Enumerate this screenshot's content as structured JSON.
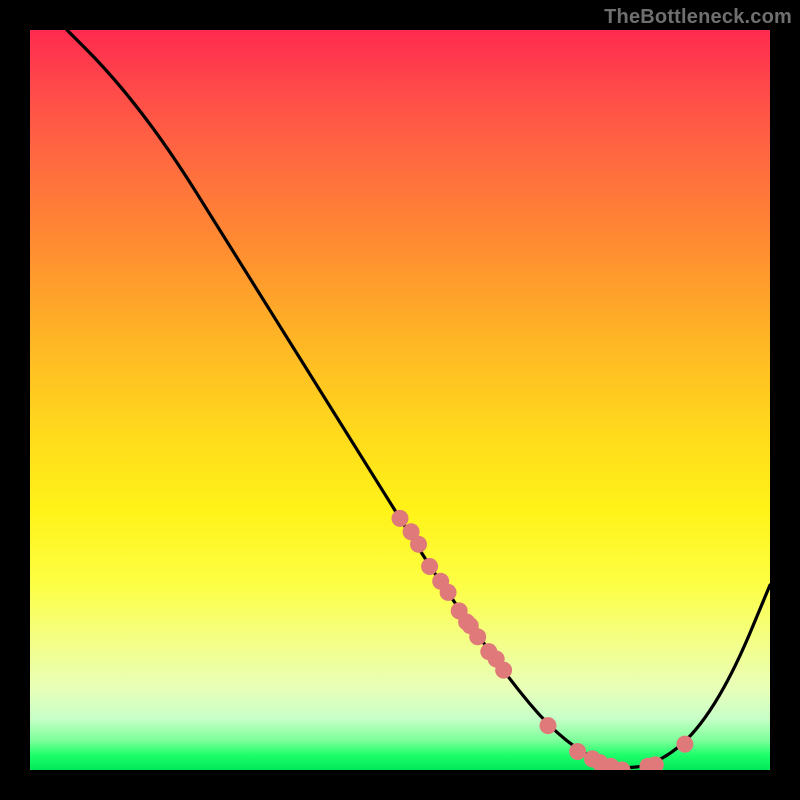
{
  "watermark": "TheBottleneck.com",
  "chart_data": {
    "type": "line",
    "title": "",
    "xlabel": "",
    "ylabel": "",
    "xlim": [
      0,
      100
    ],
    "ylim": [
      0,
      100
    ],
    "grid": false,
    "legend": false,
    "series": [
      {
        "name": "curve",
        "x": [
          5,
          10,
          15,
          20,
          25,
          30,
          35,
          40,
          45,
          50,
          55,
          60,
          65,
          70,
          75,
          80,
          85,
          90,
          95,
          100
        ],
        "y": [
          100,
          95,
          89,
          82,
          74,
          66,
          58,
          50,
          42,
          34,
          26,
          19,
          12,
          6,
          2,
          0,
          1,
          5,
          13,
          25
        ],
        "color": "#000000"
      },
      {
        "name": "data-points",
        "type": "scatter",
        "x": [
          50,
          51.5,
          52.5,
          54,
          55.5,
          56.5,
          58,
          59,
          59.5,
          60.5,
          62,
          63,
          64,
          70,
          74,
          76,
          77,
          78.5,
          80,
          83.5,
          84.5,
          88.5
        ],
        "y": [
          34,
          32.2,
          30.5,
          27.5,
          25.5,
          24,
          21.5,
          20,
          19.5,
          18,
          16,
          15,
          13.5,
          6,
          2.5,
          1.5,
          1,
          0.5,
          0,
          0.5,
          0.7,
          3.5
        ],
        "color": "#e07a7a"
      }
    ]
  }
}
